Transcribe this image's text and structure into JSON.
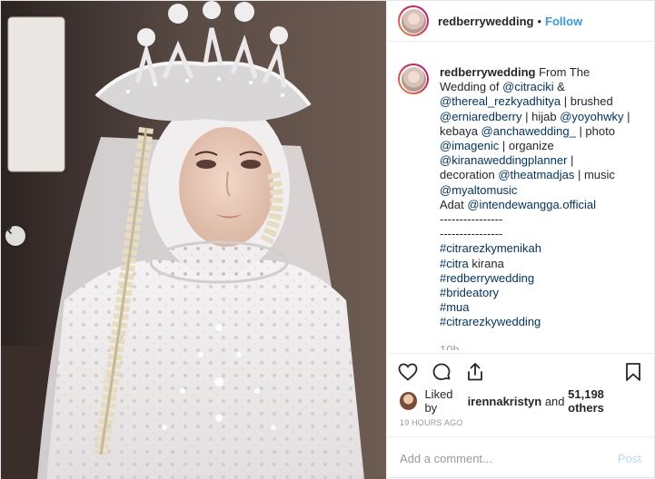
{
  "post": {
    "username": "redberrywedding",
    "follow_label": "Follow",
    "separator": "•"
  },
  "caption": {
    "username": "redberrywedding",
    "lines": [
      [
        "From The"
      ],
      [
        "Wedding of ",
        "@citraciki",
        " &"
      ],
      [
        "@thereal_rezkyadhitya",
        " | brushed"
      ],
      [
        "@erniaredberry",
        " | hijab ",
        "@yoyohwky",
        " |"
      ],
      [
        "kebaya ",
        "@anchawedding_",
        " | photo"
      ],
      [
        "@imagenic",
        " | organize"
      ],
      [
        "@kiranaweddingplanner",
        " |"
      ],
      [
        "decoration ",
        "@theatmadjas",
        " | music"
      ],
      [
        "@myaltomusic"
      ],
      [
        "Adat ",
        "@intendewangga.official"
      ],
      [
        "----------------"
      ],
      [
        "----------------"
      ],
      [
        "#citrarezkymenikah"
      ],
      [
        "#citra",
        " kirana"
      ],
      [
        "#redberrywedding"
      ],
      [
        "#brideatory"
      ],
      [
        "#mua"
      ],
      [
        "#citrarezkywedding"
      ]
    ],
    "cut_off_text": "10h"
  },
  "likes": {
    "prefix": "Liked by ",
    "user": "irennakristyn",
    "middle": " and ",
    "others": "51,198 others"
  },
  "timestamp": "19 HOURS AGO",
  "comment_box": {
    "placeholder": "Add a comment...",
    "post_label": "Post"
  },
  "icons": {
    "prev": "chevron-left-icon",
    "like": "heart-icon",
    "comment": "comment-bubble-icon",
    "share": "share-icon",
    "save": "bookmark-icon"
  },
  "colors": {
    "link": "#003569",
    "follow": "#3897f0",
    "post_disabled": "#b3dbff",
    "muted": "#999999"
  }
}
